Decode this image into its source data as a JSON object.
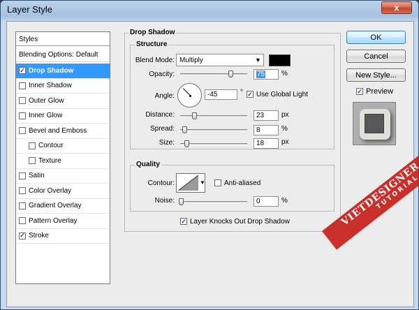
{
  "window": {
    "title": "Layer Style",
    "close_glyph": "x"
  },
  "styles_panel": {
    "header": "Styles",
    "blending_options": "Blending Options: Default",
    "items": [
      {
        "label": "Drop Shadow",
        "checked": true,
        "selected": true
      },
      {
        "label": "Inner Shadow",
        "checked": false
      },
      {
        "label": "Outer Glow",
        "checked": false
      },
      {
        "label": "Inner Glow",
        "checked": false
      },
      {
        "label": "Bevel and Emboss",
        "checked": false
      },
      {
        "label": "Contour",
        "checked": false,
        "sub": true
      },
      {
        "label": "Texture",
        "checked": false,
        "sub": true
      },
      {
        "label": "Satin",
        "checked": false
      },
      {
        "label": "Color Overlay",
        "checked": false
      },
      {
        "label": "Gradient Overlay",
        "checked": false
      },
      {
        "label": "Pattern Overlay",
        "checked": false
      },
      {
        "label": "Stroke",
        "checked": true
      }
    ]
  },
  "drop_shadow": {
    "title": "Drop Shadow",
    "structure": {
      "title": "Structure",
      "blend_mode_label": "Blend Mode:",
      "blend_mode_value": "Multiply",
      "shadow_color": "#000000",
      "opacity_label": "Opacity:",
      "opacity_value": "75",
      "opacity_unit": "%",
      "angle_label": "Angle:",
      "angle_value": "-45",
      "angle_unit": "°",
      "use_global_light_label": "Use Global Light",
      "use_global_light_checked": true,
      "distance_label": "Distance:",
      "distance_value": "23",
      "distance_unit": "px",
      "spread_label": "Spread:",
      "spread_value": "8",
      "spread_unit": "%",
      "size_label": "Size:",
      "size_value": "18",
      "size_unit": "px"
    },
    "quality": {
      "title": "Quality",
      "contour_label": "Contour:",
      "anti_aliased_label": "Anti-aliased",
      "anti_aliased_checked": false,
      "noise_label": "Noise:",
      "noise_value": "0",
      "noise_unit": "%"
    },
    "knockout_label": "Layer Knocks Out Drop Shadow",
    "knockout_checked": true
  },
  "buttons": {
    "ok": "OK",
    "cancel": "Cancel",
    "new_style": "New Style...",
    "preview_label": "Preview",
    "preview_checked": true
  },
  "watermark": {
    "main": "VIETDESIGNER.NET",
    "sub": "TUTORIAL"
  },
  "colors": {
    "selection": "#3399ff",
    "dialog_bg": "#ececec",
    "titlebar": "#b9d1ea",
    "close": "#c2452b"
  }
}
